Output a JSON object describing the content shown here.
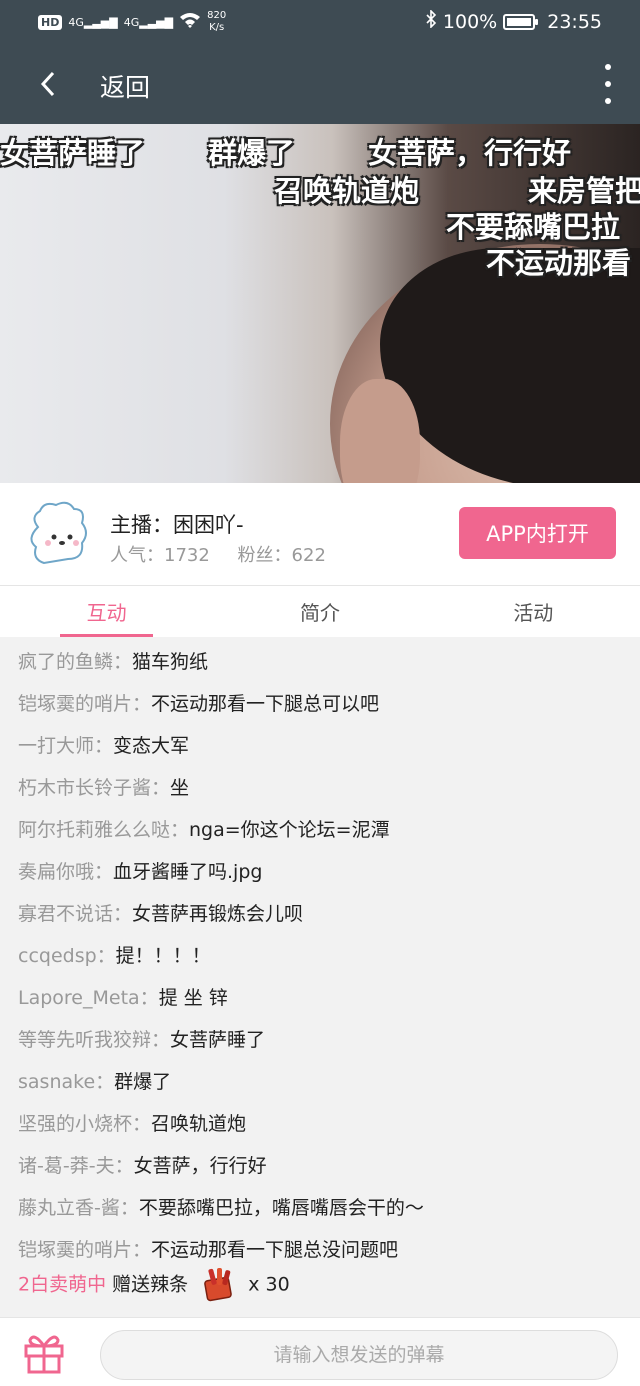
{
  "status_bar": {
    "hd": "HD",
    "signal1": "4G",
    "signal2": "4G",
    "speed_value": "820",
    "speed_unit": "K/s",
    "battery": "100%",
    "time": "23:55"
  },
  "header": {
    "back_label": "返回"
  },
  "video": {
    "danmaku": [
      "女菩萨睡了",
      "群爆了",
      "女菩萨，行行好",
      "召唤轨道炮",
      "来房管把",
      "不要舔嘴巴拉",
      "不运动那看"
    ]
  },
  "anchor": {
    "name_label": "主播：困困吖-",
    "popularity": "人气：1732",
    "fans": "粉丝：622",
    "open_button": "APP内打开"
  },
  "tabs": [
    {
      "label": "互动",
      "active": true
    },
    {
      "label": "简介",
      "active": false
    },
    {
      "label": "活动",
      "active": false
    }
  ],
  "chat": [
    {
      "user": "疯了的鱼鳞：",
      "text": "猫车狗纸"
    },
    {
      "user": "铠塚霙的哨片：",
      "text": "不运动那看一下腿总可以吧"
    },
    {
      "user": "一打大师：",
      "text": "变态大军"
    },
    {
      "user": "朽木市长铃子酱：",
      "text": "坐"
    },
    {
      "user": "阿尔托莉雅么么哒：",
      "text": "nga=你这个论坛=泥潭"
    },
    {
      "user": "奏扁你哦：",
      "text": "血牙酱睡了吗.jpg"
    },
    {
      "user": "寡君不说话：",
      "text": "女菩萨再锻炼会儿呗"
    },
    {
      "user": "ccqedsp：",
      "text": "提！！！！"
    },
    {
      "user": "Lapore_Meta：",
      "text": "提 坐 锌"
    },
    {
      "user": "等等先听我狡辩：",
      "text": "女菩萨睡了"
    },
    {
      "user": "sasnake：",
      "text": "群爆了"
    },
    {
      "user": "坚强的小烧杯：",
      "text": "召唤轨道炮"
    },
    {
      "user": "诸-葛-莽-夫：",
      "text": "女菩萨，行行好"
    },
    {
      "user": "藤丸立香-酱：",
      "text": "不要舔嘴巴拉，嘴唇嘴唇会干的～"
    },
    {
      "user": "铠塚霙的哨片：",
      "text": "不运动那看一下腿总没问题吧"
    }
  ],
  "gift_message": {
    "user": "2白卖萌中",
    "action": "赠送辣条",
    "count": "x 30"
  },
  "input": {
    "placeholder": "请输入想发送的弹幕"
  },
  "colors": {
    "accent": "#f0668f",
    "header_bg": "#3e4b53"
  }
}
